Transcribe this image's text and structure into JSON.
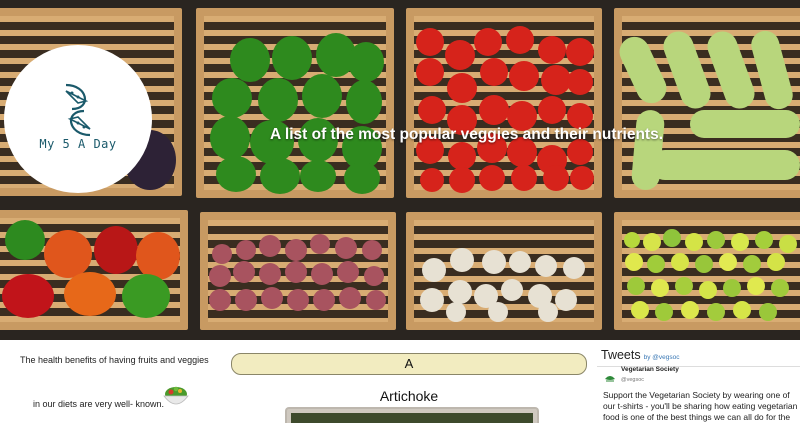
{
  "site": {
    "logo_text": "My 5 A Day",
    "tagline": "A list of the most popular veggies and their nutrients."
  },
  "intro": {
    "line1": "The health benefits of having fruits and veggies",
    "line2": "in our diets are very well- known."
  },
  "section": {
    "letter": "A",
    "item_title": "Artichoke"
  },
  "tweets": {
    "title": "Tweets",
    "by": "by @vegsoc",
    "author": "Vegetarian Society",
    "handle": "@vegsoc",
    "text": "Support the Vegetarian Society by wearing one of our t-shirts - you'll be sharing how eating vegetarian food is one of the best things we can all do for the"
  },
  "icons": {
    "logo": "watermelon-slice-icon",
    "salad": "salad-bowl-icon"
  },
  "colors": {
    "logo_teal": "#1b5a6b",
    "pill_bg": "#f2ecc0",
    "twitter_link": "#3a78b5"
  }
}
